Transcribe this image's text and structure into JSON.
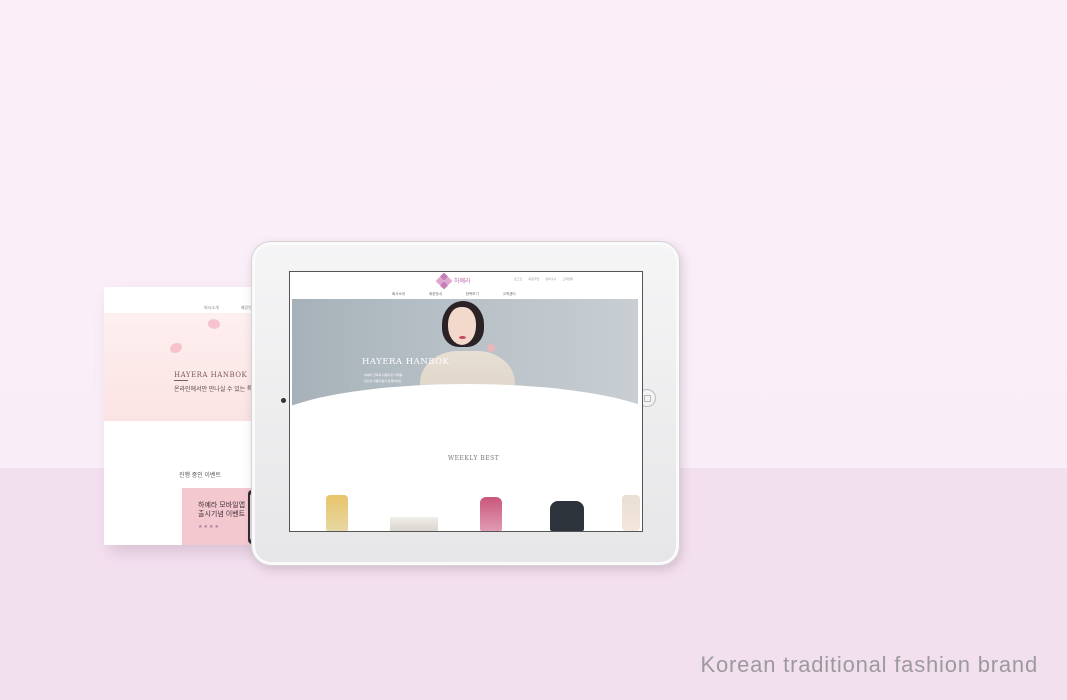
{
  "paper": {
    "nav": [
      "회사소개",
      "매장안내"
    ],
    "hero_title": "HAYERA HANBOK",
    "hero_subtitle": "온라인에서만 만나실 수 있는 특가",
    "section_title": "진행 중인 이벤트",
    "banner_text": "하예라 모바일앱\n출시기념 이벤트"
  },
  "site": {
    "logo_text": "하예라",
    "util_links": [
      "로그인",
      "회원가입",
      "장바구니",
      "고객센터"
    ],
    "nav": [
      "회사소개",
      "매장안내",
      "한복보기",
      "고객센터"
    ],
    "hero_title": "HAYERA HANBOK",
    "hero_line1": "하예라 한복의 아름다운 자태를",
    "hero_line2": "당신의 아름다움과 함께하세요",
    "weekly_title": "WEEKLY BEST"
  },
  "caption": "Korean traditional fashion brand",
  "colors": {
    "wall": "#fbeef8",
    "floor": "#f3e0ef",
    "brand_pink": "#c06aa8"
  }
}
